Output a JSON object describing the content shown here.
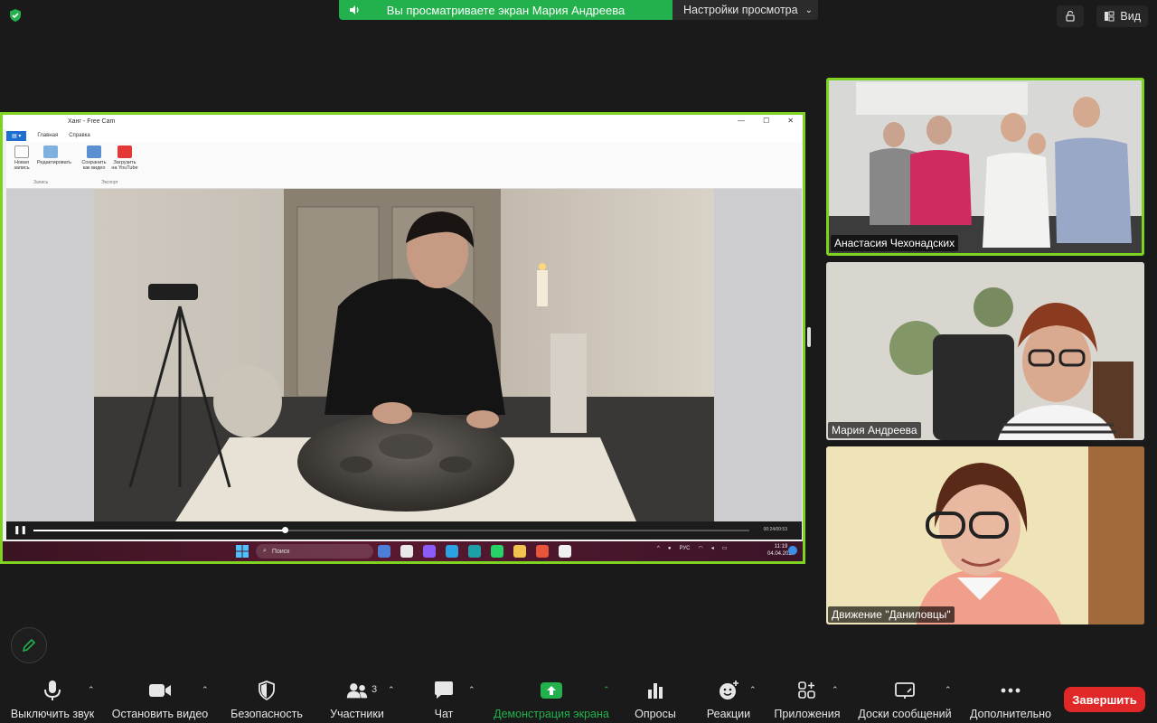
{
  "top": {
    "share_banner_text": "Вы просматриваете экран Мария Андреева",
    "view_options_label": "Настройки просмотра",
    "view_button_label": "Вид"
  },
  "shared_screen": {
    "window_title": "Ханг - Free Cam",
    "ribbon_tabs": [
      "Главная",
      "Справка"
    ],
    "ribbon_items": [
      "Новая запись",
      "Редактировать",
      "Сохранить как видео",
      "Загрузить на YouTube"
    ],
    "ribbon_groups": [
      "Запись",
      "Экспорт"
    ],
    "player_time": "00:24/00:53",
    "taskbar_search": "Поиск",
    "tray_lang": "РУС",
    "clock_time": "11:19",
    "clock_date": "04.04.2023"
  },
  "participants": [
    {
      "name": "Анастасия Чехонадских"
    },
    {
      "name": "Мария Андреева"
    },
    {
      "name": "Движение \"Даниловцы\""
    }
  ],
  "toolbar": {
    "mute": "Выключить звук",
    "stop_video": "Остановить видео",
    "security": "Безопасность",
    "participants": "Участники",
    "participants_count": "3",
    "chat": "Чат",
    "share_screen": "Демонстрация экрана",
    "polls": "Опросы",
    "reactions": "Реакции",
    "apps": "Приложения",
    "whiteboards": "Доски сообщений",
    "more": "Дополнительно",
    "end": "Завершить"
  },
  "colors": {
    "accent_green": "#22b14c",
    "active_border": "#7ed321",
    "end_red": "#e02828"
  }
}
